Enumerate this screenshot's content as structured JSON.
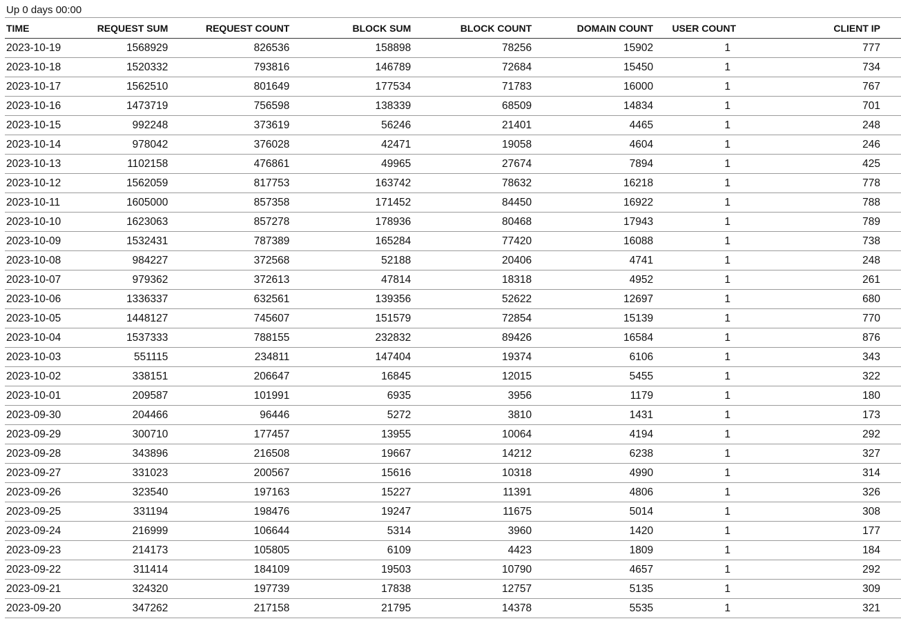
{
  "status": {
    "uptime": "Up 0 days 00:00"
  },
  "table": {
    "headers": [
      "TIME",
      "REQUEST SUM",
      "REQUEST COUNT",
      "BLOCK SUM",
      "BLOCK COUNT",
      "DOMAIN COUNT",
      "USER COUNT",
      "CLIENT IP"
    ],
    "rows": [
      [
        "2023-10-19",
        "1568929",
        "826536",
        "158898",
        "78256",
        "15902",
        "1",
        "777"
      ],
      [
        "2023-10-18",
        "1520332",
        "793816",
        "146789",
        "72684",
        "15450",
        "1",
        "734"
      ],
      [
        "2023-10-17",
        "1562510",
        "801649",
        "177534",
        "71783",
        "16000",
        "1",
        "767"
      ],
      [
        "2023-10-16",
        "1473719",
        "756598",
        "138339",
        "68509",
        "14834",
        "1",
        "701"
      ],
      [
        "2023-10-15",
        "992248",
        "373619",
        "56246",
        "21401",
        "4465",
        "1",
        "248"
      ],
      [
        "2023-10-14",
        "978042",
        "376028",
        "42471",
        "19058",
        "4604",
        "1",
        "246"
      ],
      [
        "2023-10-13",
        "1102158",
        "476861",
        "49965",
        "27674",
        "7894",
        "1",
        "425"
      ],
      [
        "2023-10-12",
        "1562059",
        "817753",
        "163742",
        "78632",
        "16218",
        "1",
        "778"
      ],
      [
        "2023-10-11",
        "1605000",
        "857358",
        "171452",
        "84450",
        "16922",
        "1",
        "788"
      ],
      [
        "2023-10-10",
        "1623063",
        "857278",
        "178936",
        "80468",
        "17943",
        "1",
        "789"
      ],
      [
        "2023-10-09",
        "1532431",
        "787389",
        "165284",
        "77420",
        "16088",
        "1",
        "738"
      ],
      [
        "2023-10-08",
        "984227",
        "372568",
        "52188",
        "20406",
        "4741",
        "1",
        "248"
      ],
      [
        "2023-10-07",
        "979362",
        "372613",
        "47814",
        "18318",
        "4952",
        "1",
        "261"
      ],
      [
        "2023-10-06",
        "1336337",
        "632561",
        "139356",
        "52622",
        "12697",
        "1",
        "680"
      ],
      [
        "2023-10-05",
        "1448127",
        "745607",
        "151579",
        "72854",
        "15139",
        "1",
        "770"
      ],
      [
        "2023-10-04",
        "1537333",
        "788155",
        "232832",
        "89426",
        "16584",
        "1",
        "876"
      ],
      [
        "2023-10-03",
        "551115",
        "234811",
        "147404",
        "19374",
        "6106",
        "1",
        "343"
      ],
      [
        "2023-10-02",
        "338151",
        "206647",
        "16845",
        "12015",
        "5455",
        "1",
        "322"
      ],
      [
        "2023-10-01",
        "209587",
        "101991",
        "6935",
        "3956",
        "1179",
        "1",
        "180"
      ],
      [
        "2023-09-30",
        "204466",
        "96446",
        "5272",
        "3810",
        "1431",
        "1",
        "173"
      ],
      [
        "2023-09-29",
        "300710",
        "177457",
        "13955",
        "10064",
        "4194",
        "1",
        "292"
      ],
      [
        "2023-09-28",
        "343896",
        "216508",
        "19667",
        "14212",
        "6238",
        "1",
        "327"
      ],
      [
        "2023-09-27",
        "331023",
        "200567",
        "15616",
        "10318",
        "4990",
        "1",
        "314"
      ],
      [
        "2023-09-26",
        "323540",
        "197163",
        "15227",
        "11391",
        "4806",
        "1",
        "326"
      ],
      [
        "2023-09-25",
        "331194",
        "198476",
        "19247",
        "11675",
        "5014",
        "1",
        "308"
      ],
      [
        "2023-09-24",
        "216999",
        "106644",
        "5314",
        "3960",
        "1420",
        "1",
        "177"
      ],
      [
        "2023-09-23",
        "214173",
        "105805",
        "6109",
        "4423",
        "1809",
        "1",
        "184"
      ],
      [
        "2023-09-22",
        "311414",
        "184109",
        "19503",
        "10790",
        "4657",
        "1",
        "292"
      ],
      [
        "2023-09-21",
        "324320",
        "197739",
        "17838",
        "12757",
        "5135",
        "1",
        "309"
      ],
      [
        "2023-09-20",
        "347262",
        "217158",
        "21795",
        "14378",
        "5535",
        "1",
        "321"
      ]
    ]
  }
}
